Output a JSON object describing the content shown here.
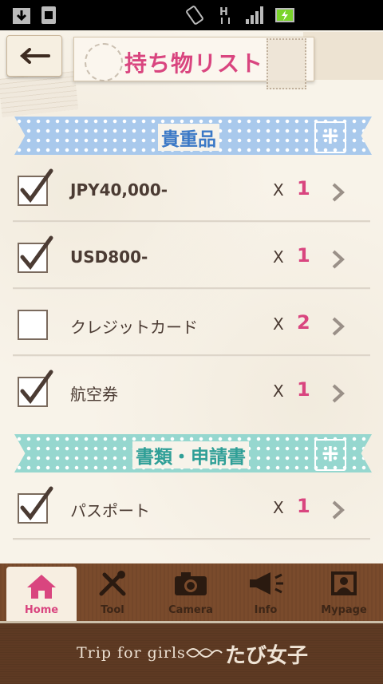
{
  "header": {
    "title": "持ち物リスト"
  },
  "sections": [
    {
      "title": "貴重品",
      "items": [
        {
          "label": "JPY40,000-",
          "checked": true,
          "qty": "1",
          "bold": true
        },
        {
          "label": "USD800-",
          "checked": true,
          "qty": "1",
          "bold": true
        },
        {
          "label": "クレジットカード",
          "checked": false,
          "qty": "2",
          "bold": false
        },
        {
          "label": "航空券",
          "checked": true,
          "qty": "1",
          "bold": false
        }
      ]
    },
    {
      "title": "書類・申請書",
      "items": [
        {
          "label": "パスポート",
          "checked": true,
          "qty": "1",
          "bold": false
        }
      ]
    }
  ],
  "multiplier_label": "X",
  "tabs": [
    {
      "label": "Home",
      "icon": "home-icon",
      "active": true
    },
    {
      "label": "Tool",
      "icon": "tools-icon",
      "active": false
    },
    {
      "label": "Camera",
      "icon": "camera-icon",
      "active": false
    },
    {
      "label": "Info",
      "icon": "megaphone-icon",
      "active": false
    },
    {
      "label": "Mypage",
      "icon": "portrait-icon",
      "active": false
    }
  ],
  "footer": {
    "tagline": "Trip for girls",
    "logo": "たび女子"
  },
  "colors": {
    "accent_pink": "#d9457f",
    "tabbar_brown": "#7a4b2c",
    "ribbon_blue": "#a9c9ec",
    "ribbon_green": "#96d7cf"
  }
}
